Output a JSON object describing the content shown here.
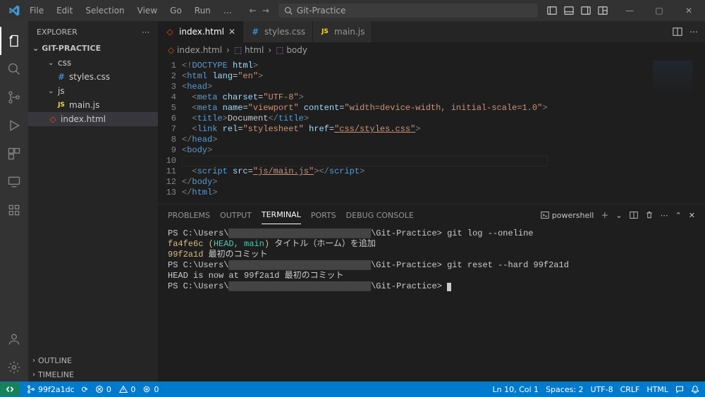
{
  "titlebar": {
    "menu": [
      "File",
      "Edit",
      "Selection",
      "View",
      "Go",
      "Run",
      "…"
    ],
    "search_placeholder": "Git-Practice",
    "nav_back": "←",
    "nav_fwd": "→"
  },
  "activitybar": {
    "items": [
      {
        "name": "explorer-icon",
        "active": true
      },
      {
        "name": "search-icon"
      },
      {
        "name": "source-control-icon"
      },
      {
        "name": "run-debug-icon"
      },
      {
        "name": "extensions-icon"
      },
      {
        "name": "remote-explorer-icon"
      },
      {
        "name": "spaces-icon"
      }
    ],
    "bottom": [
      {
        "name": "account-icon"
      },
      {
        "name": "settings-gear-icon"
      }
    ]
  },
  "sidebar": {
    "title": "EXPLORER",
    "project": "GIT-PRACTICE",
    "tree": [
      {
        "type": "folder",
        "name": "css",
        "expanded": true,
        "depth": 1
      },
      {
        "type": "file",
        "name": "styles.css",
        "icon": "css",
        "depth": 2
      },
      {
        "type": "folder",
        "name": "js",
        "expanded": true,
        "depth": 1
      },
      {
        "type": "file",
        "name": "main.js",
        "icon": "js",
        "depth": 2
      },
      {
        "type": "file",
        "name": "index.html",
        "icon": "html",
        "depth": 1,
        "selected": true
      }
    ],
    "footer": [
      "OUTLINE",
      "TIMELINE"
    ]
  },
  "tabs": [
    {
      "label": "index.html",
      "icon": "html",
      "active": true,
      "close": true
    },
    {
      "label": "styles.css",
      "icon": "css"
    },
    {
      "label": "main.js",
      "icon": "js"
    }
  ],
  "breadcrumb": [
    {
      "icon": "html",
      "label": "index.html"
    },
    {
      "icon": "cube",
      "label": "html"
    },
    {
      "icon": "cube",
      "label": "body"
    }
  ],
  "code": {
    "lines": [
      {
        "n": 1,
        "html": "<span class='tok-gray'>&lt;!</span><span class='tok-doct'>DOCTYPE</span> <span class='tok-attr'>html</span><span class='tok-gray'>&gt;</span>"
      },
      {
        "n": 2,
        "html": "<span class='tok-gray'>&lt;</span><span class='tok-tag'>html</span> <span class='tok-attr'>lang</span>=<span class='tok-str'>\"en\"</span><span class='tok-gray'>&gt;</span>"
      },
      {
        "n": 3,
        "html": "<span class='tok-gray'>&lt;</span><span class='tok-tag'>head</span><span class='tok-gray'>&gt;</span>"
      },
      {
        "n": 4,
        "html": "  <span class='tok-gray'>&lt;</span><span class='tok-tag'>meta</span> <span class='tok-attr'>charset</span>=<span class='tok-str'>\"UTF-8\"</span><span class='tok-gray'>&gt;</span>"
      },
      {
        "n": 5,
        "html": "  <span class='tok-gray'>&lt;</span><span class='tok-tag'>meta</span> <span class='tok-attr'>name</span>=<span class='tok-str'>\"viewport\"</span> <span class='tok-attr'>content</span>=<span class='tok-str'>\"width=device-width, initial-scale=1.0\"</span><span class='tok-gray'>&gt;</span>"
      },
      {
        "n": 6,
        "html": "  <span class='tok-gray'>&lt;</span><span class='tok-tag'>title</span><span class='tok-gray'>&gt;</span>Document<span class='tok-gray'>&lt;/</span><span class='tok-tag'>title</span><span class='tok-gray'>&gt;</span>"
      },
      {
        "n": 7,
        "html": "  <span class='tok-gray'>&lt;</span><span class='tok-tag'>link</span> <span class='tok-attr'>rel</span>=<span class='tok-str'>\"stylesheet\"</span> <span class='tok-attr'>href</span>=<span class='tok-link'>\"css/styles.css\"</span><span class='tok-gray'>&gt;</span>"
      },
      {
        "n": 8,
        "html": "<span class='tok-gray'>&lt;/</span><span class='tok-tag'>head</span><span class='tok-gray'>&gt;</span>"
      },
      {
        "n": 9,
        "html": "<span class='tok-gray'>&lt;</span><span class='tok-tag'>body</span><span class='tok-gray'>&gt;</span>"
      },
      {
        "n": 10,
        "html": "",
        "cursor": true
      },
      {
        "n": 11,
        "html": "  <span class='tok-gray'>&lt;</span><span class='tok-tag'>script</span> <span class='tok-attr'>src</span>=<span class='tok-link'>\"js/main.js\"</span><span class='tok-gray'>&gt;&lt;/</span><span class='tok-tag'>script</span><span class='tok-gray'>&gt;</span>"
      },
      {
        "n": 12,
        "html": "<span class='tok-gray'>&lt;/</span><span class='tok-tag'>body</span><span class='tok-gray'>&gt;</span>"
      },
      {
        "n": 13,
        "html": "<span class='tok-gray'>&lt;/</span><span class='tok-tag'>html</span><span class='tok-gray'>&gt;</span>"
      }
    ]
  },
  "panel": {
    "tabs": [
      "PROBLEMS",
      "OUTPUT",
      "TERMINAL",
      "PORTS",
      "DEBUG CONSOLE"
    ],
    "active": "TERMINAL",
    "shell_label": "powershell"
  },
  "terminal": {
    "lines": [
      {
        "html": "PS C:\\Users\\<span class='term-blur'>████████████████████████████</span>\\Git-Practice> git log --oneline"
      },
      {
        "html": "<span class='term-yellow'>fa4fe6c (</span><span class='term-green'>HEAD, main</span><span class='term-yellow'>)</span> タイトル（ホーム）を追加"
      },
      {
        "html": "<span class='term-yellow'>99f2a1d</span> 最初のコミット"
      },
      {
        "html": "PS C:\\Users\\<span class='term-blur'>████████████████████████████</span>\\Git-Practice> git reset --hard 99f2a1d"
      },
      {
        "html": "HEAD is now at 99f2a1d 最初のコミット"
      },
      {
        "html": "PS C:\\Users\\<span class='term-blur'>████████████████████████████</span>\\Git-Practice> <span class='term-cursor'></span>"
      }
    ]
  },
  "statusbar": {
    "branch": "99f2a1dc",
    "sync": "⟳",
    "errors": "0",
    "warnings": "0",
    "ports": "0",
    "ln_col": "Ln 10, Col 1",
    "spaces": "Spaces: 2",
    "encoding": "UTF-8",
    "eol": "CRLF",
    "lang": "HTML",
    "notifications": "🔔"
  }
}
